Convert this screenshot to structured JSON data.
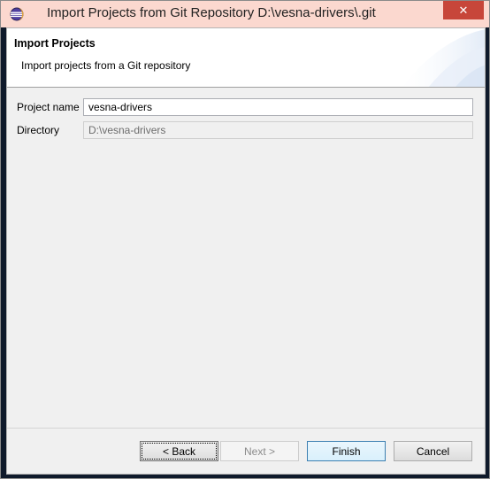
{
  "window": {
    "title": "Import Projects from Git Repository D:\\vesna-drivers\\.git",
    "close_glyph": "✕",
    "app_icon": "eclipse-icon"
  },
  "banner": {
    "title": "Import Projects",
    "description": "Import projects from a Git repository"
  },
  "form": {
    "project_name": {
      "label": "Project name",
      "value": "vesna-drivers"
    },
    "directory": {
      "label": "Directory",
      "value": "D:\\vesna-drivers"
    }
  },
  "buttons": {
    "back": "< Back",
    "next": "Next >",
    "finish": "Finish",
    "cancel": "Cancel"
  },
  "colors": {
    "titlebar": "#fbd8cf",
    "close_button": "#c7463a",
    "dialog_background": "#f0f0f0"
  }
}
